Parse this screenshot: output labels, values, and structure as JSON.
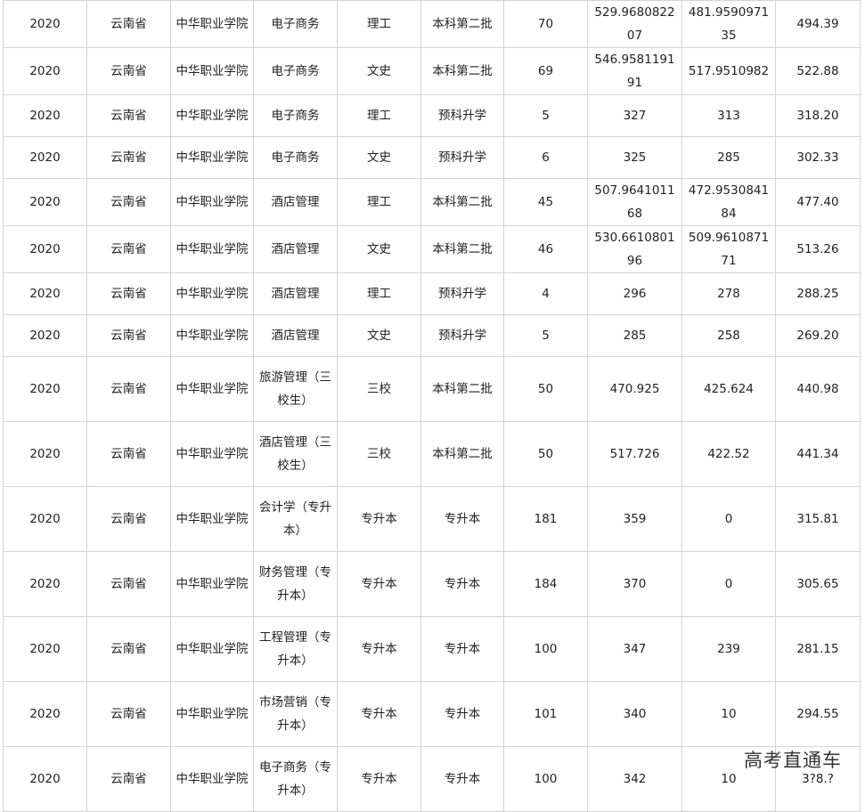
{
  "rows": [
    [
      "2020",
      "云南省",
      "中华职业学院",
      "电子商务",
      "理工",
      "本科第二批",
      "70",
      "529.968082207",
      "481.959097135",
      "494.39"
    ],
    [
      "2020",
      "云南省",
      "中华职业学院",
      "电子商务",
      "文史",
      "本科第二批",
      "69",
      "546.958119191",
      "517.9510982",
      "522.88"
    ],
    [
      "2020",
      "云南省",
      "中华职业学院",
      "电子商务",
      "理工",
      "预科升学",
      "5",
      "327",
      "313",
      "318.20"
    ],
    [
      "2020",
      "云南省",
      "中华职业学院",
      "电子商务",
      "文史",
      "预科升学",
      "6",
      "325",
      "285",
      "302.33"
    ],
    [
      "2020",
      "云南省",
      "中华职业学院",
      "酒店管理",
      "理工",
      "本科第二批",
      "45",
      "507.964101168",
      "472.953084184",
      "477.40"
    ],
    [
      "2020",
      "云南省",
      "中华职业学院",
      "酒店管理",
      "文史",
      "本科第二批",
      "46",
      "530.661080196",
      "509.961087171",
      "513.26"
    ],
    [
      "2020",
      "云南省",
      "中华职业学院",
      "酒店管理",
      "理工",
      "预科升学",
      "4",
      "296",
      "278",
      "288.25"
    ],
    [
      "2020",
      "云南省",
      "中华职业学院",
      "酒店管理",
      "文史",
      "预科升学",
      "5",
      "285",
      "258",
      "269.20"
    ],
    [
      "2020",
      "云南省",
      "中华职业学院",
      "旅游管理（三校生）",
      "三校",
      "本科第二批",
      "50",
      "470.925",
      "425.624",
      "440.98"
    ],
    [
      "2020",
      "云南省",
      "中华职业学院",
      "酒店管理（三校生）",
      "三校",
      "本科第二批",
      "50",
      "517.726",
      "422.52",
      "441.34"
    ],
    [
      "2020",
      "云南省",
      "中华职业学院",
      "会计学（专升本）",
      "专升本",
      "专升本",
      "181",
      "359",
      "0",
      "315.81"
    ],
    [
      "2020",
      "云南省",
      "中华职业学院",
      "财务管理（专升本）",
      "专升本",
      "专升本",
      "184",
      "370",
      "0",
      "305.65"
    ],
    [
      "2020",
      "云南省",
      "中华职业学院",
      "工程管理（专升本）",
      "专升本",
      "专升本",
      "100",
      "347",
      "239",
      "281.15"
    ],
    [
      "2020",
      "云南省",
      "中华职业学院",
      "市场营销（专升本）",
      "专升本",
      "专升本",
      "101",
      "340",
      "10",
      "294.55"
    ],
    [
      "2020",
      "云南省",
      "中华职业学院",
      "电子商务（专升本）",
      "专升本",
      "专升本",
      "100",
      "342",
      "10",
      "3?8.?"
    ]
  ],
  "watermark": "高考直通车"
}
